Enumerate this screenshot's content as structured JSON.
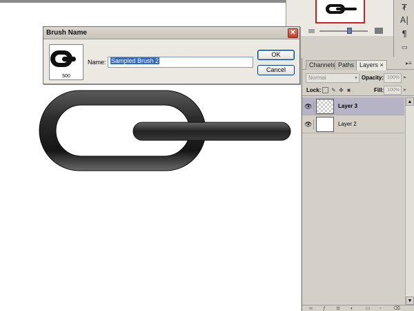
{
  "dialog": {
    "title": "Brush Name",
    "close_glyph": "✕",
    "brush_size": "500",
    "name_label": "Name:",
    "name_value": "Sampled Brush 2",
    "ok_label": "OK",
    "cancel_label": "Cancel"
  },
  "layers_panel": {
    "tabs": [
      {
        "label": "Channels"
      },
      {
        "label": "Paths"
      },
      {
        "label": "Layers ×"
      }
    ],
    "blend_mode": "Normal",
    "opacity_label": "Opacity:",
    "opacity_value": "100%",
    "lock_label": "Lock:",
    "fill_label": "Fill:",
    "fill_value": "100%",
    "layers": [
      {
        "name": "Layer 3",
        "selected": true
      },
      {
        "name": "Layer 2",
        "selected": false
      }
    ]
  },
  "tool_strip": {
    "items": [
      {
        "icon": "character-panel-icon",
        "glyph": "₮"
      },
      {
        "icon": "type-tool-icon",
        "glyph": "A|"
      },
      {
        "icon": "paragraph-icon",
        "glyph": "¶"
      }
    ]
  },
  "navigator": {
    "zoom_fraction": 0.62
  },
  "colors": {
    "link_dark": "#2a2a2a",
    "selection_blue": "#3169c6",
    "close_red": "#c53a24",
    "nav_frame_red": "#d12020"
  }
}
